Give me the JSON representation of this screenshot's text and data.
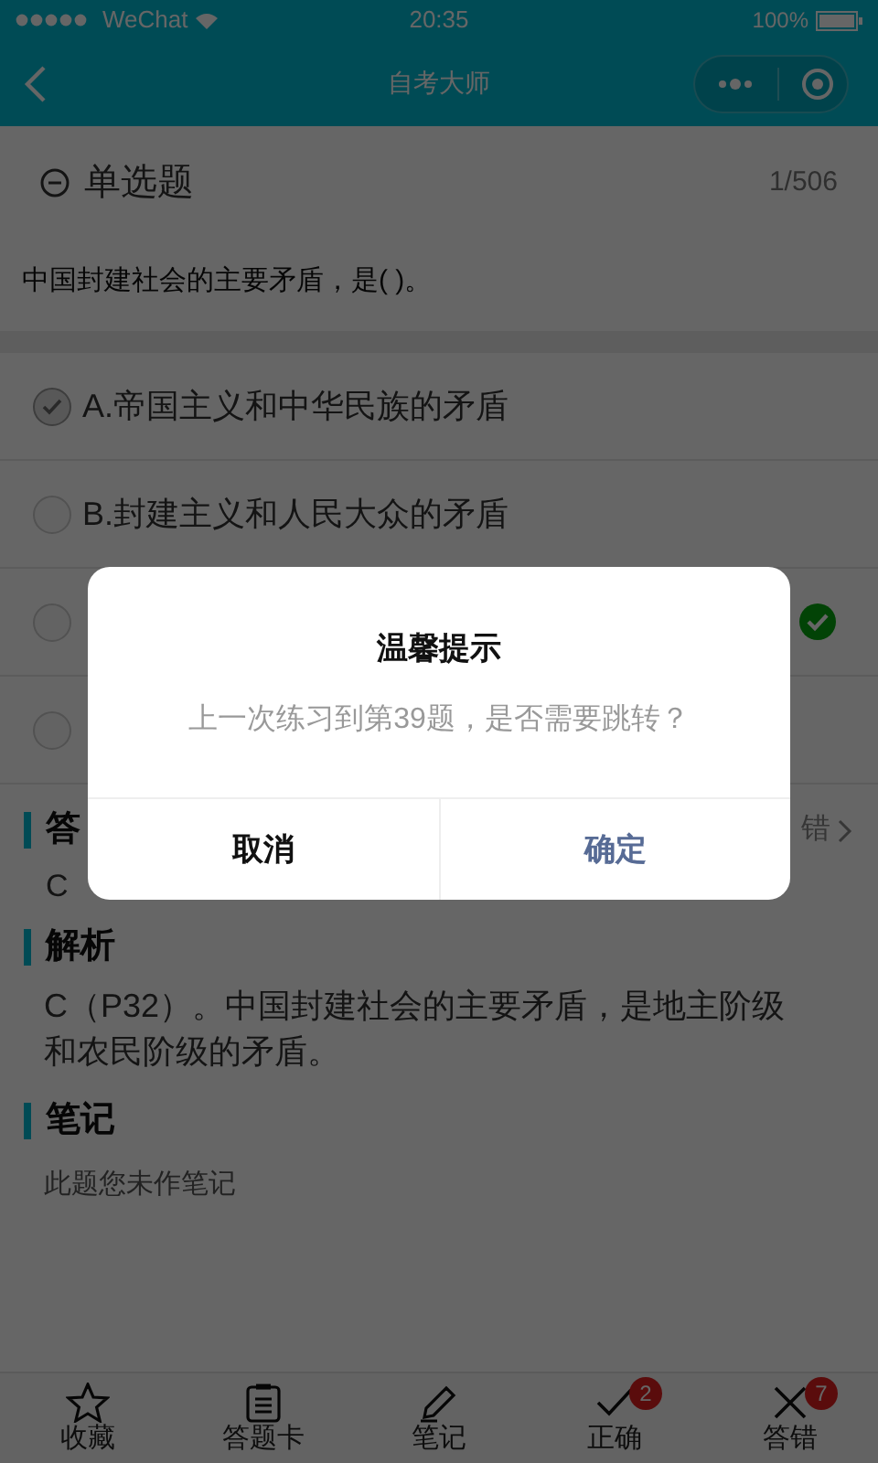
{
  "status_bar": {
    "carrier": "WeChat",
    "time": "20:35",
    "battery": "100%"
  },
  "nav": {
    "title": "自考大师"
  },
  "question": {
    "type_label": "单选题",
    "progress": "1/506",
    "stem": "中国封建社会的主要矛盾，是( )。"
  },
  "options": [
    {
      "label": "A.帝国主义和中华民族的矛盾",
      "selected": true,
      "correct": false
    },
    {
      "label": "B.封建主义和人民大众的矛盾",
      "selected": false,
      "correct": false
    },
    {
      "selected": false,
      "correct": true
    },
    {
      "selected": false,
      "correct": false
    }
  ],
  "answer": {
    "heading": "答",
    "report": "错",
    "value": "C"
  },
  "analysis": {
    "heading": "解析",
    "text": "C（P32）。中国封建社会的主要矛盾，是地主阶级和农民阶级的矛盾。"
  },
  "notes": {
    "heading": "笔记",
    "text": "此题您未作笔记"
  },
  "dialog": {
    "title": "温馨提示",
    "message": "上一次练习到第39题，是否需要跳转？",
    "buttons": [
      {
        "label": "取消",
        "kind": "cancel"
      },
      {
        "label": "确定",
        "kind": "confirm"
      }
    ]
  },
  "tab_bar": [
    {
      "label": "收藏",
      "kind": "star"
    },
    {
      "label": "答题卡",
      "kind": "card"
    },
    {
      "label": "笔记",
      "kind": "pencil"
    },
    {
      "label": "正确",
      "kind": "check",
      "badge": "2"
    },
    {
      "label": "答错",
      "kind": "cross",
      "badge": "7"
    }
  ]
}
